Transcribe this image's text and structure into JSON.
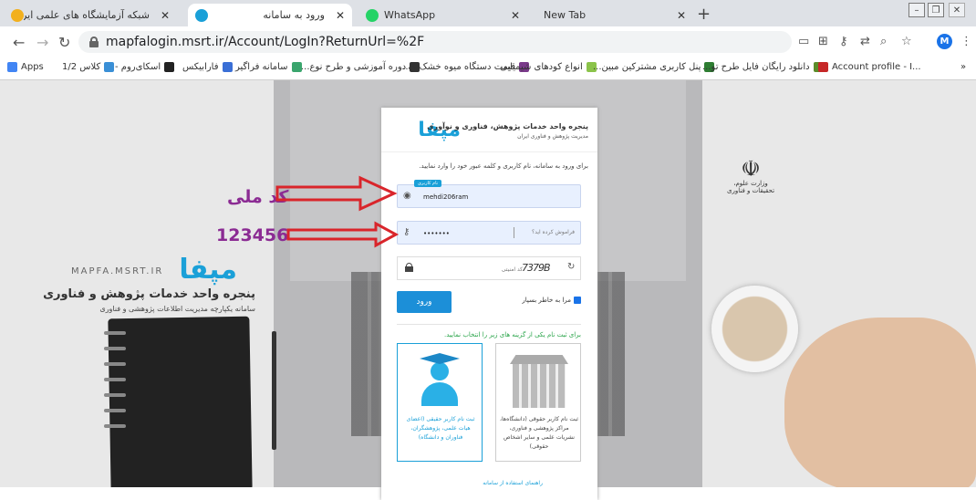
{
  "browser": {
    "tabs": [
      {
        "title": "شبکه آزمایشگاه های علمی ایران",
        "active": false
      },
      {
        "title": "ورود به سامانه",
        "active": true
      },
      {
        "title": "WhatsApp",
        "active": false
      },
      {
        "title": "New Tab",
        "active": false
      }
    ],
    "url": "mapfalogin.msrt.ir/Account/LogIn?ReturnUrl=%2F",
    "avatar_letter": "M",
    "bookmarks": [
      "Apps",
      "کلاس 1/2",
      "اسکای‌روم -",
      "فارابیکس",
      "سامانه فراگیر",
      "دوره آموزشی و طرح نوع...",
      "قیمت دستگاه میوه خشک ک...",
      "انواع کودهای شیمیایی",
      "پنل کاربری مشترکین مبین...",
      "دانلود رایگان فایل طرح تو...",
      "Account profile - I..."
    ],
    "more": "»"
  },
  "background": {
    "logo_en": "MAPFA.MSRT.IR",
    "logo_mark": "مپفا",
    "title": "پنجره واحد خدمات پژوهش و فناوری",
    "subtitle": "سامانه یکپارچه مدیریت اطلاعات پژوهشی و فناوری",
    "emblem_text": "وزارت علوم، تحقیقات و فناوری"
  },
  "panel": {
    "logo_mark": "مپفا",
    "title": "پنجره واحد خدمات پژوهش، فناوری و نوآوری",
    "subtitle": "مدیریت پژوهش و فناوری ایران",
    "intro": "برای ورود به سامانه، نام کاربری و کلمه عبور خود را وارد نمایید.",
    "username_tag": "نام کاربری",
    "username_value": "mehdi206ram",
    "password_value": "•••••••",
    "forgot": "فراموش کرده اید؟",
    "captcha_placeholder": "کد امنیتی",
    "captcha_text": "7379B",
    "login": "ورود",
    "remember": "مرا به خاطر بسپار",
    "choose": "برای ثبت نام یکی از گزینه های زیر را انتخاب نمایید.",
    "card_individual": "ثبت نام کاربر حقیقی (اعضای هیات علمی، پژوهشگران، فناوران و دانشگاه)",
    "card_legal": "ثبت نام کاربر حقوقی (دانشگاه‌ها، مراکز پژوهشی و فناوری، نشریات علمی و سایر اشخاص حقوقی)",
    "bottom_link": "راهنمای استفاده از سامانه"
  },
  "annotations": {
    "label1": "کد ملی",
    "label2": "123456",
    "arrow_color": "#d9252b",
    "label_color": "#8b2b93"
  }
}
